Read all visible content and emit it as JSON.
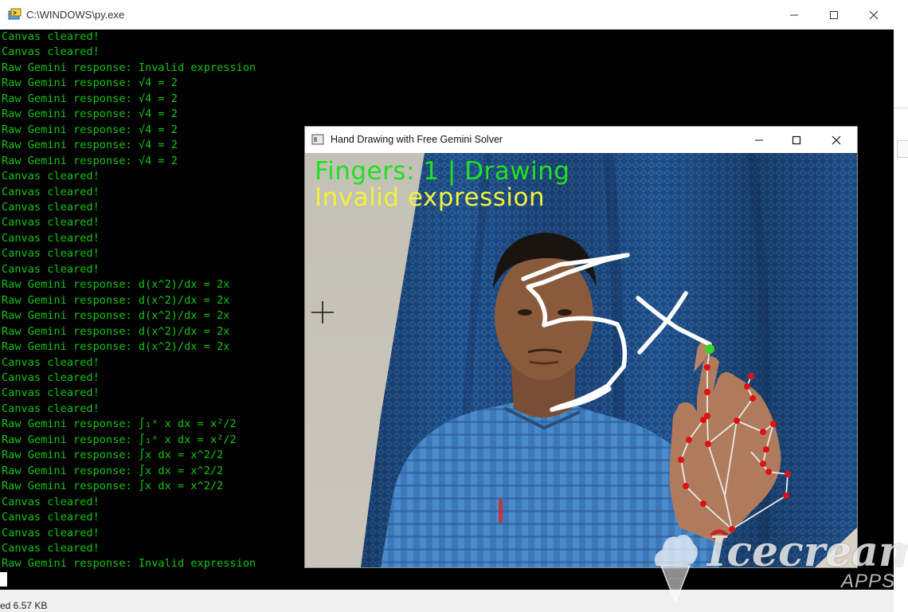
{
  "console": {
    "title": "C:\\WINDOWS\\py.exe",
    "lines": [
      "Canvas cleared!",
      "Canvas cleared!",
      "Raw Gemini response: Invalid expression",
      "Raw Gemini response: √4 = 2",
      "Raw Gemini response: √4 = 2",
      "Raw Gemini response: √4 = 2",
      "Raw Gemini response: √4 = 2",
      "Raw Gemini response: √4 = 2",
      "Raw Gemini response: √4 = 2",
      "Canvas cleared!",
      "Canvas cleared!",
      "Canvas cleared!",
      "Canvas cleared!",
      "Canvas cleared!",
      "Canvas cleared!",
      "Canvas cleared!",
      "Raw Gemini response: d(x^2)/dx = 2x",
      "Raw Gemini response: d(x^2)/dx = 2x",
      "Raw Gemini response: d(x^2)/dx = 2x",
      "Raw Gemini response: d(x^2)/dx = 2x",
      "Raw Gemini response: d(x^2)/dx = 2x",
      "Canvas cleared!",
      "Canvas cleared!",
      "Canvas cleared!",
      "Canvas cleared!",
      "Raw Gemini response: ∫₁ˣ x dx = x²/2",
      "Raw Gemini response: ∫₁ˣ x dx = x²/2",
      "Raw Gemini response: ∫x dx = x^2/2",
      "Raw Gemini response: ∫x dx = x^2/2",
      "Raw Gemini response: ∫x dx = x^2/2",
      "Canvas cleared!",
      "Canvas cleared!",
      "Canvas cleared!",
      "Canvas cleared!",
      "Raw Gemini response: Invalid expression"
    ]
  },
  "camera_window": {
    "title": "Hand Drawing with Free Gemini Solver",
    "overlay_line1": "Fingers: 1 | Drawing",
    "overlay_line2": "Invalid expression",
    "colors": {
      "status": "#22e022",
      "result": "#f2f23a",
      "landmark": "#e01010",
      "stroke": "#ffffff"
    }
  },
  "window_controls": {
    "minimize": "—",
    "maximize": "☐",
    "close": "✕"
  },
  "status_bar": {
    "text": "ed  6.57 KB"
  },
  "watermark": {
    "brand": "Icecream",
    "sub": "APPS"
  },
  "icons": [
    "terminal-icon",
    "opencv-window-icon",
    "minimize-icon",
    "maximize-icon",
    "close-icon",
    "crosshair-icon",
    "icecream-logo-icon"
  ]
}
